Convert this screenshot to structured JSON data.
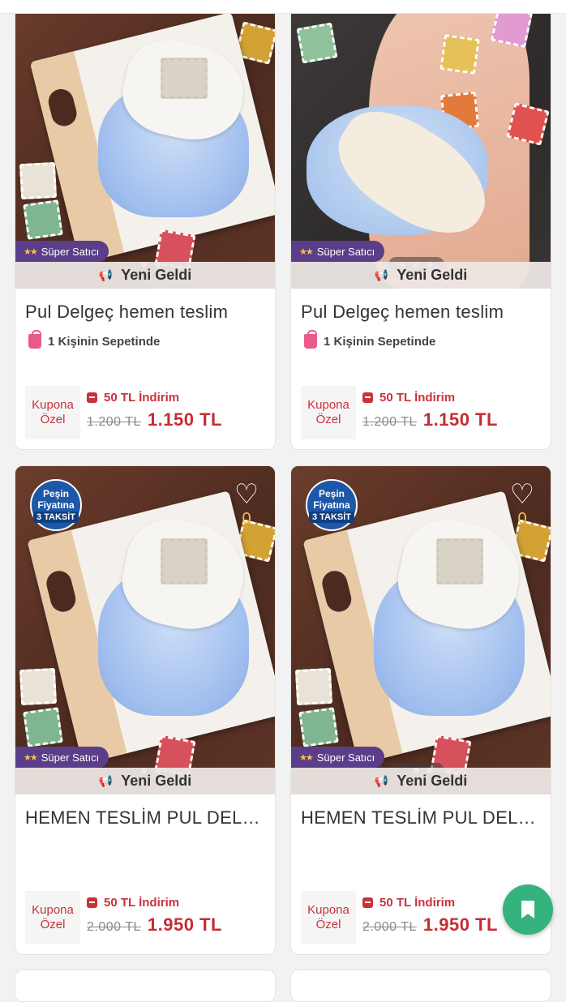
{
  "products": [
    {
      "super_seller": "Süper Satıcı",
      "new_label": "Yeni Geldi",
      "title": "Pul Delgeç hemen teslim",
      "basket_text": "1 Kişinin Sepetinde",
      "coupon_label_1": "Kupona",
      "coupon_label_2": "Özel",
      "discount": "50 TL İndirim",
      "old_price": "1.200 TL",
      "new_price": "1.150 TL"
    },
    {
      "super_seller": "Süper Satıcı",
      "new_label": "Yeni Geldi",
      "title": "Pul Delgeç hemen teslim",
      "basket_text": "1 Kişinin Sepetinde",
      "coupon_label_1": "Kupona",
      "coupon_label_2": "Özel",
      "discount": "50 TL İndirim",
      "old_price": "1.200 TL",
      "new_price": "1.150 TL"
    },
    {
      "badge_line1": "Peşin",
      "badge_line2": "Fiyatına",
      "badge_line3": "3 TAKSİT",
      "fav_count": "0",
      "super_seller": "Süper Satıcı",
      "new_label": "Yeni Geldi",
      "title": "HEMEN TESLİM PUL DELGEÇ",
      "coupon_label_1": "Kupona",
      "coupon_label_2": "Özel",
      "discount": "50 TL İndirim",
      "old_price": "2.000 TL",
      "new_price": "1.950 TL"
    },
    {
      "badge_line1": "Peşin",
      "badge_line2": "Fiyatına",
      "badge_line3": "3 TAKSİT",
      "fav_count": "0",
      "super_seller": "Süper Satıcı",
      "new_label": "Yeni Geldi",
      "title": "HEMEN TESLİM PUL DELGEÇ",
      "coupon_label_1": "Kupona",
      "coupon_label_2": "Özel",
      "discount": "50 TL İndirim",
      "old_price": "2.000 TL",
      "new_price": "1.950 TL"
    }
  ],
  "icons": {
    "super_seller": "stars-icon",
    "new_label": "megaphone-icon",
    "basket": "shopping-bag-icon",
    "coupon": "coupon-icon",
    "favorite": "heart-icon",
    "fab": "bookmark-icon"
  },
  "colors": {
    "price_red": "#c62c34",
    "super_seller_purple": "#5a3e8a",
    "badge_blue": "#1d57a8",
    "fab_green": "#35b27d"
  }
}
